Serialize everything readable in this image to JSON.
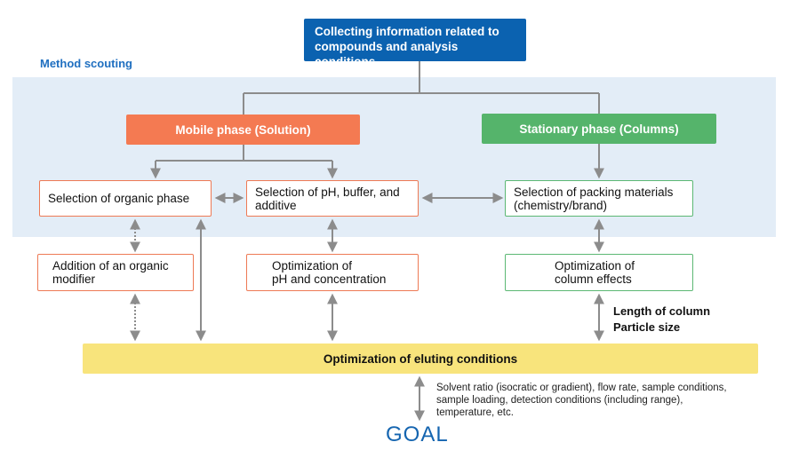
{
  "section_label": "Method scouting",
  "top_box": {
    "line1": "Collecting information related to",
    "line2": "compounds and analysis conditions"
  },
  "phases": {
    "mobile": "Mobile phase (Solution)",
    "stationary": "Stationary phase (Columns)"
  },
  "nodes": {
    "organic_phase": {
      "line1": "Selection of organic phase",
      "line2": ""
    },
    "ph_buffer": {
      "line1": "Selection of pH, buffer, and",
      "line2": "additive"
    },
    "packing": {
      "line1": "Selection of packing materials",
      "line2": "(chemistry/brand)"
    },
    "organic_modifier": {
      "line1": "Addition of an organic",
      "line2": "modifier"
    },
    "ph_concentration": {
      "line1": "Optimization of",
      "line2": "pH and concentration"
    },
    "column_effects": {
      "line1": "Optimization of",
      "line2": "column effects"
    }
  },
  "column_notes": [
    "Length of column",
    "Particle size"
  ],
  "eluting": "Optimization of eluting conditions",
  "goal_notes": [
    "Solvent ratio (isocratic or gradient), flow rate, sample conditions,",
    "sample loading, detection conditions (including range),",
    "temperature, etc."
  ],
  "goal": "GOAL",
  "colors": {
    "band": "#e3edf7",
    "top_box": "#0b62b0",
    "mobile": "#f47a52",
    "stationary": "#55b46b",
    "eluting": "#f8e47c",
    "connector": "#8c8c8c",
    "goal": "#1565b0"
  }
}
